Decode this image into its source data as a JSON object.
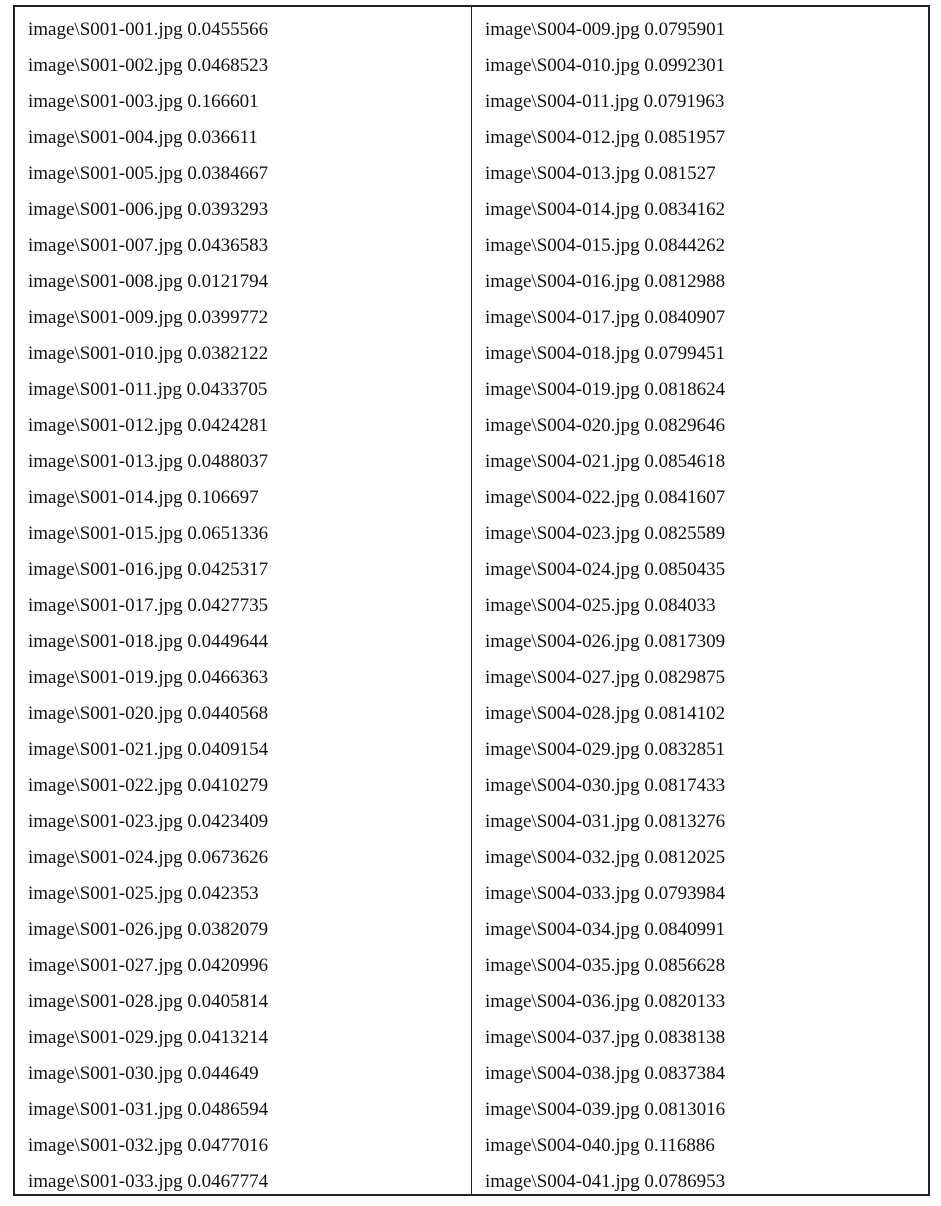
{
  "left_column": [
    "image\\S001-001.jpg 0.0455566",
    "image\\S001-002.jpg 0.0468523",
    "image\\S001-003.jpg 0.166601",
    "image\\S001-004.jpg 0.036611",
    "image\\S001-005.jpg 0.0384667",
    "image\\S001-006.jpg 0.0393293",
    "image\\S001-007.jpg 0.0436583",
    "image\\S001-008.jpg 0.0121794",
    "image\\S001-009.jpg 0.0399772",
    "image\\S001-010.jpg 0.0382122",
    "image\\S001-011.jpg 0.0433705",
    "image\\S001-012.jpg 0.0424281",
    "image\\S001-013.jpg 0.0488037",
    "image\\S001-014.jpg 0.106697",
    "image\\S001-015.jpg 0.0651336",
    "image\\S001-016.jpg 0.0425317",
    "image\\S001-017.jpg 0.0427735",
    "image\\S001-018.jpg 0.0449644",
    "image\\S001-019.jpg 0.0466363",
    "image\\S001-020.jpg 0.0440568",
    "image\\S001-021.jpg 0.0409154",
    "image\\S001-022.jpg 0.0410279",
    "image\\S001-023.jpg 0.0423409",
    "image\\S001-024.jpg 0.0673626",
    "image\\S001-025.jpg 0.042353",
    "image\\S001-026.jpg 0.0382079",
    "image\\S001-027.jpg 0.0420996",
    "image\\S001-028.jpg 0.0405814",
    "image\\S001-029.jpg 0.0413214",
    "image\\S001-030.jpg 0.044649",
    "image\\S001-031.jpg 0.0486594",
    "image\\S001-032.jpg 0.0477016",
    "image\\S001-033.jpg 0.0467774"
  ],
  "right_column": [
    "image\\S004-009.jpg 0.0795901",
    "image\\S004-010.jpg 0.0992301",
    "image\\S004-011.jpg 0.0791963",
    "image\\S004-012.jpg 0.0851957",
    "image\\S004-013.jpg 0.081527",
    "image\\S004-014.jpg 0.0834162",
    "image\\S004-015.jpg 0.0844262",
    "image\\S004-016.jpg 0.0812988",
    "image\\S004-017.jpg 0.0840907",
    "image\\S004-018.jpg 0.0799451",
    "image\\S004-019.jpg 0.0818624",
    "image\\S004-020.jpg 0.0829646",
    "image\\S004-021.jpg 0.0854618",
    "image\\S004-022.jpg 0.0841607",
    "image\\S004-023.jpg 0.0825589",
    "image\\S004-024.jpg 0.0850435",
    "image\\S004-025.jpg 0.084033",
    "image\\S004-026.jpg 0.0817309",
    "image\\S004-027.jpg 0.0829875",
    "image\\S004-028.jpg 0.0814102",
    "image\\S004-029.jpg 0.0832851",
    "image\\S004-030.jpg 0.0817433",
    "image\\S004-031.jpg 0.0813276",
    "image\\S004-032.jpg 0.0812025",
    "image\\S004-033.jpg 0.0793984",
    "image\\S004-034.jpg 0.0840991",
    "image\\S004-035.jpg 0.0856628",
    "image\\S004-036.jpg 0.0820133",
    "image\\S004-037.jpg 0.0838138",
    "image\\S004-038.jpg 0.0837384",
    "image\\S004-039.jpg 0.0813016",
    "image\\S004-040.jpg 0.116886",
    "image\\S004-041.jpg 0.0786953"
  ]
}
